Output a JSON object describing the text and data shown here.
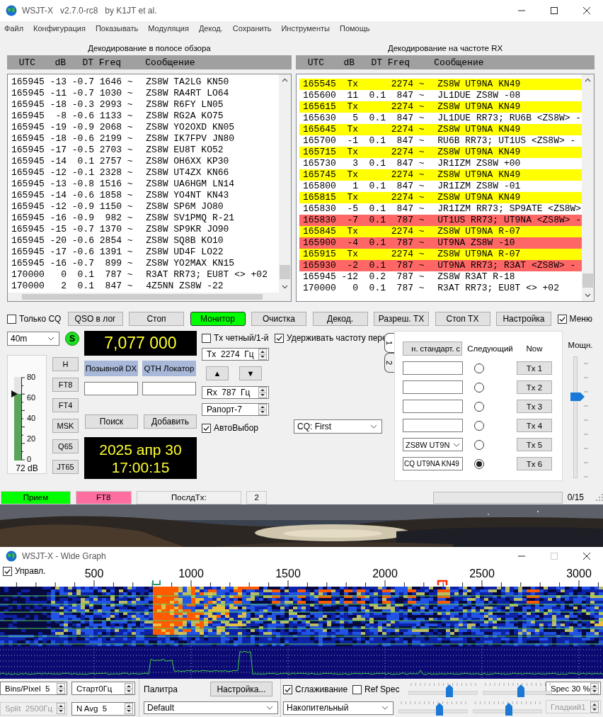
{
  "window": {
    "title": "WSJT-X   v2.7.0-rc8   by K1JT et al."
  },
  "menu": [
    "Файл",
    "Конфигурация",
    "Показывать",
    "Модуляция",
    "Декод.",
    "Сохранить",
    "Инструменты",
    "Помощь"
  ],
  "band_activity": {
    "title": "Декодирование в полосе обзора",
    "columns": [
      "UTC",
      "dB",
      "DT",
      "Freq",
      "Сообщение"
    ],
    "rows": [
      {
        "utc": "165945",
        "db": "-13",
        "dt": "-0.7",
        "freq": "1646",
        "mode": "~",
        "message": "ZS8W TA2LG KN50"
      },
      {
        "utc": "165945",
        "db": "-11",
        "dt": "-0.7",
        "freq": "1030",
        "mode": "~",
        "message": "ZS8W RA4RT LO64"
      },
      {
        "utc": "165945",
        "db": "-18",
        "dt": "-0.3",
        "freq": "2993",
        "mode": "~",
        "message": "ZS8W R6FY LN05"
      },
      {
        "utc": "165945",
        "db": "-8",
        "dt": "-0.6",
        "freq": "1133",
        "mode": "~",
        "message": "ZS8W RG2A KO75"
      },
      {
        "utc": "165945",
        "db": "-19",
        "dt": "-0.9",
        "freq": "2068",
        "mode": "~",
        "message": "ZS8W YO2OXD KN05"
      },
      {
        "utc": "165945",
        "db": "-18",
        "dt": "-0.6",
        "freq": "2199",
        "mode": "~",
        "message": "ZS8W IK7FPV JN80"
      },
      {
        "utc": "165945",
        "db": "-17",
        "dt": "-0.5",
        "freq": "2703",
        "mode": "~",
        "message": "ZS8W EU8T KO52"
      },
      {
        "utc": "165945",
        "db": "-14",
        "dt": "0.1",
        "freq": "2757",
        "mode": "~",
        "message": "ZS8W OH6XX KP30"
      },
      {
        "utc": "165945",
        "db": "-12",
        "dt": "-0.1",
        "freq": "2328",
        "mode": "~",
        "message": "ZS8W UT4ZX KN66"
      },
      {
        "utc": "165945",
        "db": "-13",
        "dt": "-0.8",
        "freq": "1516",
        "mode": "~",
        "message": "ZS8W UA6HGM LN14"
      },
      {
        "utc": "165945",
        "db": "-14",
        "dt": "-0.6",
        "freq": "1858",
        "mode": "~",
        "message": "ZS8W YO4NT KN43"
      },
      {
        "utc": "165945",
        "db": "-12",
        "dt": "-0.9",
        "freq": "1150",
        "mode": "~",
        "message": "ZS8W SP6M JO80"
      },
      {
        "utc": "165945",
        "db": "-16",
        "dt": "-0.9",
        "freq": "982",
        "mode": "~",
        "message": "ZS8W SV1PMQ R-21"
      },
      {
        "utc": "165945",
        "db": "-15",
        "dt": "-0.7",
        "freq": "1370",
        "mode": "~",
        "message": "ZS8W SP9KR JO90"
      },
      {
        "utc": "165945",
        "db": "-20",
        "dt": "-0.6",
        "freq": "2854",
        "mode": "~",
        "message": "ZS8W SQ8B KO10"
      },
      {
        "utc": "165945",
        "db": "-17",
        "dt": "-0.6",
        "freq": "1391",
        "mode": "~",
        "message": "ZS8W UD4F LO22"
      },
      {
        "utc": "165945",
        "db": "-16",
        "dt": "-0.7",
        "freq": "899",
        "mode": "~",
        "message": "ZS8W YO2MAX KN15"
      },
      {
        "utc": "170000",
        "db": "0",
        "dt": "0.1",
        "freq": "787",
        "mode": "~",
        "message": "R3AT RR73; EU8T <> +02"
      },
      {
        "utc": "170000",
        "db": "2",
        "dt": "0.1",
        "freq": "847",
        "mode": "~",
        "message": "4Z5NN ZS8W -22"
      }
    ]
  },
  "rx_frequency": {
    "title": "Декодирование на частоте RX",
    "columns": [
      "UTC",
      "dB",
      "DT",
      "Freq",
      "Сообщение"
    ],
    "rows": [
      {
        "utc": "165545",
        "db": "Tx",
        "freq": "2274",
        "mode": "~",
        "message": "ZS8W UT9NA KN49",
        "color": "#ffff00"
      },
      {
        "utc": "165600",
        "db": "11",
        "dt": "0.1",
        "freq": "847",
        "mode": "~",
        "message": "JL1DUE ZS8W -08",
        "color": "#ffffff"
      },
      {
        "utc": "165615",
        "db": "Tx",
        "freq": "2274",
        "mode": "~",
        "message": "ZS8W UT9NA KN49",
        "color": "#ffff00"
      },
      {
        "utc": "165630",
        "db": "5",
        "dt": "0.1",
        "freq": "847",
        "mode": "~",
        "message": "JL1DUE RR73; RU6B <ZS8W> -",
        "color": "#ffffff"
      },
      {
        "utc": "165645",
        "db": "Tx",
        "freq": "2274",
        "mode": "~",
        "message": "ZS8W UT9NA KN49",
        "color": "#ffff00"
      },
      {
        "utc": "165700",
        "db": "-1",
        "dt": "0.1",
        "freq": "847",
        "mode": "~",
        "message": "RU6B RR73; UT1US <ZS8W> -",
        "color": "#ffffff"
      },
      {
        "utc": "165715",
        "db": "Tx",
        "freq": "2274",
        "mode": "~",
        "message": "ZS8W UT9NA KN49",
        "color": "#ffff00"
      },
      {
        "utc": "165730",
        "db": "3",
        "dt": "0.1",
        "freq": "847",
        "mode": "~",
        "message": "JR1IZM ZS8W +00",
        "color": "#ffffff"
      },
      {
        "utc": "165745",
        "db": "Tx",
        "freq": "2274",
        "mode": "~",
        "message": "ZS8W UT9NA KN49",
        "color": "#ffff00"
      },
      {
        "utc": "165800",
        "db": "1",
        "dt": "0.1",
        "freq": "847",
        "mode": "~",
        "message": "JR1IZM ZS8W -01",
        "color": "#ffffff"
      },
      {
        "utc": "165815",
        "db": "Tx",
        "freq": "2274",
        "mode": "~",
        "message": "ZS8W UT9NA KN49",
        "color": "#ffff00"
      },
      {
        "utc": "165830",
        "db": "-5",
        "dt": "0.1",
        "freq": "847",
        "mode": "~",
        "message": "JR1IZM RR73; SP9ATE <ZS8W>",
        "color": "#ffffff"
      },
      {
        "utc": "165830",
        "db": "-7",
        "dt": "0.1",
        "freq": "787",
        "mode": "~",
        "message": "UT1US RR73; UT9NA <ZS8W> -",
        "color": "#ff6666"
      },
      {
        "utc": "165845",
        "db": "Tx",
        "freq": "2274",
        "mode": "~",
        "message": "ZS8W UT9NA R-07",
        "color": "#ffff00"
      },
      {
        "utc": "165900",
        "db": "-4",
        "dt": "0.1",
        "freq": "787",
        "mode": "~",
        "message": "UT9NA ZS8W -10",
        "color": "#ff6666"
      },
      {
        "utc": "165915",
        "db": "Tx",
        "freq": "2274",
        "mode": "~",
        "message": "ZS8W UT9NA R-07",
        "color": "#ffff00"
      },
      {
        "utc": "165930",
        "db": "-2",
        "dt": "0.1",
        "freq": "787",
        "mode": "~",
        "message": "UT9NA RR73; R3AT <ZS8W> -",
        "color": "#ff6666"
      },
      {
        "utc": "165945",
        "db": "-12",
        "dt": "0.2",
        "freq": "787",
        "mode": "~",
        "message": "ZS8W R3AT R-18",
        "color": "#ffffff"
      },
      {
        "utc": "170000",
        "db": "0",
        "dt": "0.1",
        "freq": "787",
        "mode": "~",
        "message": "R3AT RR73; EU8T <> +02",
        "color": "#ffffff"
      }
    ]
  },
  "toolbar": {
    "only_cq": {
      "label": "Только CQ",
      "checked": false
    },
    "buttons": [
      {
        "label": "QSO в лог",
        "on": false
      },
      {
        "label": "Стоп",
        "on": false
      },
      {
        "label": "Монитор",
        "on": true
      },
      {
        "label": "Очистка",
        "on": false
      },
      {
        "label": "Декод.",
        "on": false
      },
      {
        "label": "Разреш. TX",
        "on": false
      },
      {
        "label": "Стоп TX",
        "on": false
      },
      {
        "label": "Настройка",
        "on": false
      }
    ],
    "menu_toggle": {
      "label": "Меню",
      "checked": true
    }
  },
  "band": "40m",
  "status_led": {
    "label": "S",
    "on": true
  },
  "signal_meter": {
    "scale": [
      "80",
      "60",
      "40",
      "20",
      "0"
    ],
    "level": 0.8,
    "reading": "72 dB"
  },
  "modes": [
    "H",
    "FT8",
    "FT4",
    "MSK",
    "Q65",
    "JT65"
  ],
  "dial_frequency": "7,077 000",
  "dx": {
    "call_label": "Позывной DX",
    "grid_label": "QTH Локатор"
  },
  "lookup_buttons": [
    "Поиск",
    "Добавить"
  ],
  "clock": {
    "date": "2025 апр 30",
    "time": "17:00:15"
  },
  "tx_even": {
    "label": "Tx четный/1-й",
    "checked": false
  },
  "tx_freq": "Tx  2274  Гц",
  "freq_arrows": [
    "▲",
    "▼"
  ],
  "rx_freq": "Rx  787  Гц",
  "report": "Рапорт-7",
  "auto_seq": {
    "label": "АвтоВыбор",
    "checked": true
  },
  "hold_tx_freq": {
    "label": "Удерживать частоту пере",
    "checked": true
  },
  "cq_mode": "CQ: First",
  "message_tabs": {
    "tabs": [
      {
        "label": "1",
        "selected": true
      },
      {
        "label": "2",
        "selected": false
      }
    ],
    "gen_button": "н. стандарт. с",
    "next_label": "Следующий",
    "now_label": "Now",
    "rows": [
      {
        "kind": "field",
        "selected": false,
        "button": "Tx 1"
      },
      {
        "kind": "field",
        "selected": false,
        "button": "Tx 2"
      },
      {
        "kind": "field",
        "selected": false,
        "button": "Tx 3"
      },
      {
        "kind": "field",
        "selected": false,
        "button": "Tx 4"
      },
      {
        "kind": "dropdown",
        "message": "ZS8W UT9N",
        "selected": false,
        "button": "Tx 5"
      },
      {
        "kind": "field",
        "message": "CQ UT9NA KN49",
        "selected": true,
        "button": "Tx 6"
      }
    ]
  },
  "power": {
    "label": "Мощн.",
    "level": 0.68
  },
  "status_bar": {
    "items": [
      {
        "text": "Прием",
        "color": "#00ff00"
      },
      {
        "text": "FT8",
        "color": "#ff6ea0"
      },
      {
        "text": "ПослдTx:",
        "color": "#f0f0f0"
      },
      {
        "text": "2",
        "color": "#f0f0f0"
      }
    ],
    "progress": {
      "level": 0
    },
    "count": "0/15"
  },
  "wide_graph": {
    "title": "WSJT-X - Wide Graph",
    "control": {
      "label": "Управл.",
      "checked": true
    },
    "axis_labels": [
      "500",
      "1000",
      "1500",
      "2000",
      "2500",
      "3000"
    ],
    "spin_boxes": [
      {
        "value": "Bins/Pixel  5",
        "disabled": false
      },
      {
        "value": "Старт0Гц",
        "disabled": false
      },
      {
        "value": "Split  2500Гц",
        "disabled": true
      },
      {
        "value": "N Avg  5",
        "disabled": false
      }
    ],
    "palette_label": "Палитра",
    "setup_button": "Настройка...",
    "palette": "Default",
    "smoothing": {
      "label": "Сглаживание",
      "checked": true
    },
    "ref_spec": {
      "label": "Ref Spec",
      "checked": false
    },
    "spectrum_mode": "Накопительный",
    "sliders": [
      {
        "level": 0.6
      },
      {
        "level": 0.55
      },
      {
        "level": 0.6
      },
      {
        "level": 0.52
      }
    ],
    "spec": {
      "value": "Spec 30 %",
      "disabled": false
    },
    "smooth": {
      "value": "Гладкий1",
      "disabled": true
    }
  }
}
